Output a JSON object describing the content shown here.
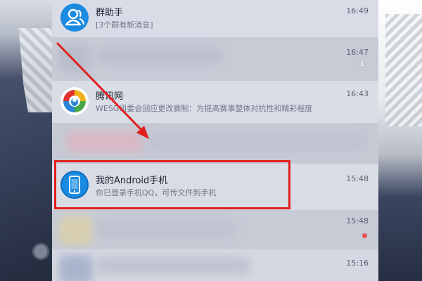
{
  "chat_list": [
    {
      "title": "群助手",
      "preview": "[3个群有新消息]",
      "time": "16:49",
      "avatar_icon": "group-helper-icon",
      "accent": "#1a8be0"
    },
    {
      "title": "",
      "preview": "",
      "time": "16:47",
      "badge": "1",
      "blurred": true
    },
    {
      "title": "腾讯网",
      "preview": "WESG组委会回应更改赛制：为提高赛事整体对抗性和精彩程度",
      "time": "16:43",
      "avatar_icon": "tencent-news-icon"
    },
    {
      "title": "",
      "preview": "",
      "time": "",
      "blurred": true
    },
    {
      "title": "我的Android手机",
      "preview": "你已登录手机QQ，可传文件到手机",
      "time": "15:48",
      "avatar_icon": "phone-icon",
      "accent": "#1a8be0",
      "highlighted": true
    },
    {
      "title": "",
      "preview": "",
      "time": "15:48",
      "blurred": true,
      "unread_dot": true
    },
    {
      "title": "",
      "preview": "",
      "time": "15:16",
      "blurred": true
    }
  ],
  "annotation_color": "#e0201e",
  "unread_dot_color": "#e8515a"
}
